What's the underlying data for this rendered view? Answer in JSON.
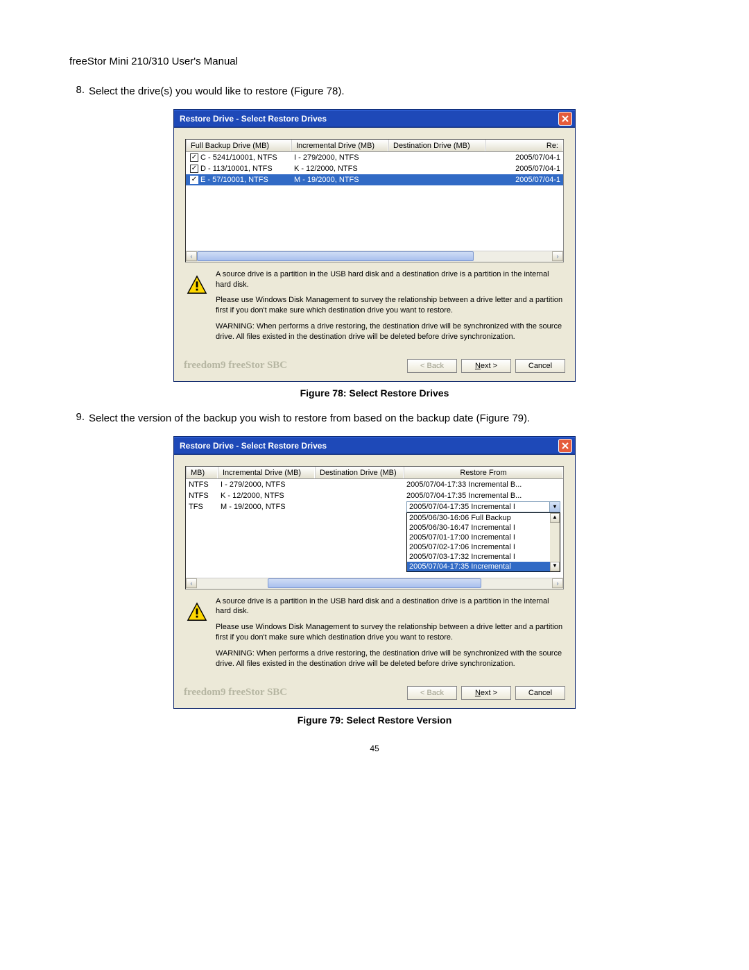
{
  "doc": {
    "header": "freeStor Mini 210/310 User's Manual",
    "page_number": "45"
  },
  "step8": {
    "num": "8.",
    "text": "Select the drive(s) you would like to restore (Figure 78)."
  },
  "step9": {
    "num": "9.",
    "text": "Select the version of the backup you wish to restore from based on the backup date (Figure 79)."
  },
  "fig78": {
    "caption": "Figure 78: Select Restore Drives",
    "title": "Restore Drive - Select Restore Drives",
    "headers": {
      "c0": "Full Backup Drive (MB)",
      "c1": "Incremental Drive (MB)",
      "c2": "Destination Drive (MB)",
      "c3": "Re:"
    },
    "rows": [
      {
        "chk": true,
        "sel": false,
        "c0": "C - 5241/10001, NTFS",
        "c1": "I - 279/2000, NTFS",
        "c2": "",
        "c3": "2005/07/04-1"
      },
      {
        "chk": true,
        "sel": false,
        "c0": "D - 113/10001, NTFS",
        "c1": "K - 12/2000, NTFS",
        "c2": "",
        "c3": "2005/07/04-1"
      },
      {
        "chk": true,
        "sel": true,
        "c0": "E - 57/10001, NTFS",
        "c1": "M - 19/2000, NTFS",
        "c2": "",
        "c3": "2005/07/04-1"
      }
    ],
    "info1": "A source drive is a partition in the USB hard disk and a destination drive is a partition in the internal hard disk.",
    "info2": "Please use Windows Disk Management to survey the relationship between a drive letter and a partition first if you don't make sure which destination drive you want to restore.",
    "info3": "WARNING: When performs a drive restoring, the destination drive will be synchronized with the source drive.  All files existed in the destination drive will be deleted before drive synchronization.",
    "brand": "freedom9 freeStor SBC",
    "back": "< Back",
    "next": "Next >",
    "cancel": "Cancel"
  },
  "fig79": {
    "caption": "Figure 79: Select Restore Version",
    "title": "Restore Drive - Select Restore Drives",
    "headers": {
      "c0": "MB)",
      "c1": "Incremental Drive (MB)",
      "c2": "Destination Drive (MB)",
      "c3": "Restore From"
    },
    "rows": [
      {
        "c0": "NTFS",
        "c1": "I - 279/2000, NTFS",
        "c2": "",
        "c3": "2005/07/04-17:33 Incremental B..."
      },
      {
        "c0": "NTFS",
        "c1": "K - 12/2000, NTFS",
        "c2": "",
        "c3": "2005/07/04-17:35 Incremental B..."
      },
      {
        "c0": "TFS",
        "c1": "M - 19/2000, NTFS",
        "c2": "",
        "c3_dropdown": true
      }
    ],
    "dropdown": {
      "selected": "2005/07/04-17:35 Incremental I",
      "options": [
        {
          "t": "2005/06/30-16:06 Full Backup",
          "sel": false
        },
        {
          "t": "2005/06/30-16:47 Incremental I",
          "sel": false
        },
        {
          "t": "2005/07/01-17:00 Incremental I",
          "sel": false
        },
        {
          "t": "2005/07/02-17:06 Incremental I",
          "sel": false
        },
        {
          "t": "2005/07/03-17:32 Incremental I",
          "sel": false
        },
        {
          "t": "2005/07/04-17:35 Incremental",
          "sel": true
        }
      ]
    },
    "info1": "A source drive is a partition in the USB hard disk and a destination drive is a partition in the internal hard disk.",
    "info2": "Please use Windows Disk Management to survey the relationship between a drive letter and a partition first if you don't make sure which destination drive you want to restore.",
    "info3": "WARNING: When performs a drive restoring, the destination drive will be synchronized with the source drive.  All files existed in the destination drive will be deleted before drive synchronization.",
    "brand": "freedom9 freeStor SBC",
    "back": "< Back",
    "next": "Next >",
    "cancel": "Cancel"
  }
}
